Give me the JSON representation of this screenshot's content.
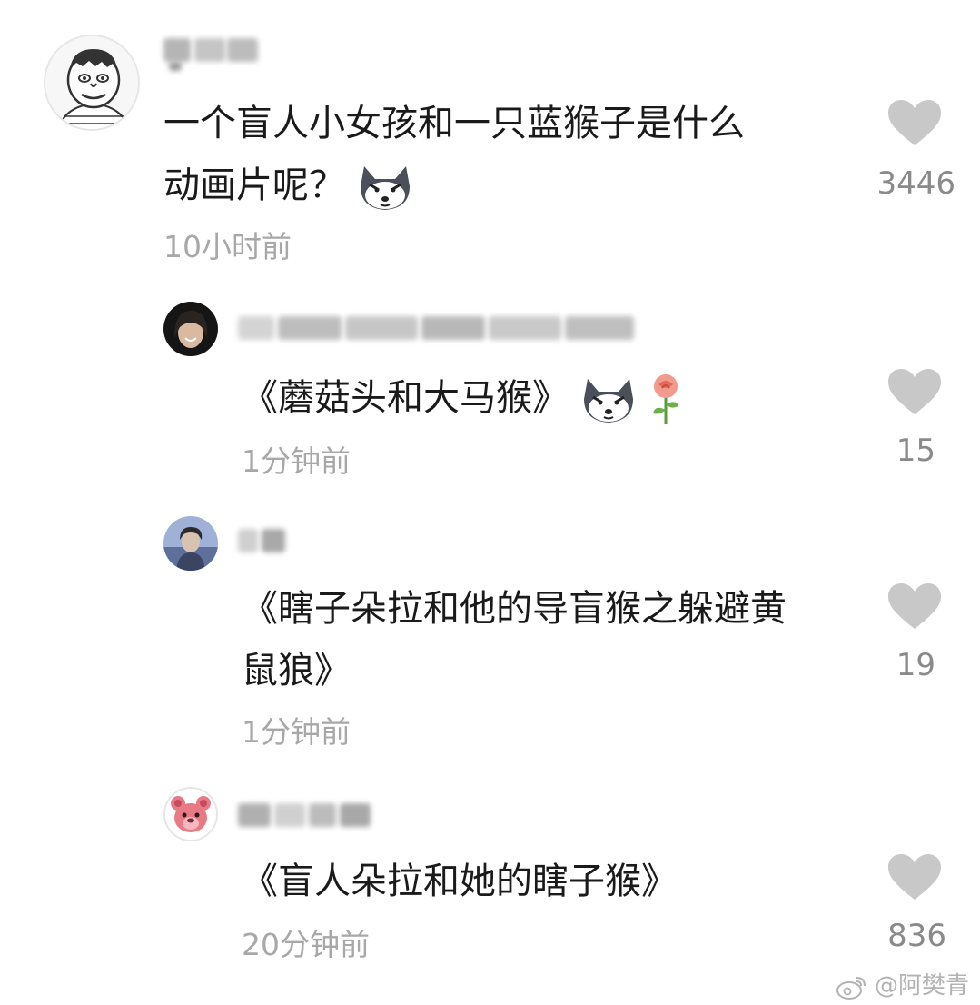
{
  "comments": [
    {
      "text_line1": "一个盲人小女孩和一只蓝猴子是什么",
      "text_line2": "动画片呢？",
      "emoji1": "husky-emoji",
      "time": "10小时前",
      "likes": "3446",
      "avatar": "cartoon-man-avatar"
    },
    {
      "text_line1": "《蘑菇头和大马猴》",
      "emoji1": "husky-emoji",
      "emoji2": "rose-emoji",
      "time": "1分钟前",
      "likes": "15",
      "avatar": "girl-photo-avatar"
    },
    {
      "text_line1": "《瞎子朵拉和他的导盲猴之躲避黄",
      "text_line2": "鼠狼》",
      "time": "1分钟前",
      "likes": "19",
      "avatar": "boy-photo-avatar"
    },
    {
      "text_line1": "《盲人朵拉和她的瞎子猴》",
      "time": "20分钟前",
      "likes": "836",
      "avatar": "bear-avatar"
    }
  ],
  "watermark": "@阿樊青",
  "colors": {
    "text": "#1a1a1a",
    "time": "#a8a8a8",
    "heart": "#c8c8c8",
    "count": "#8a8a8a"
  }
}
